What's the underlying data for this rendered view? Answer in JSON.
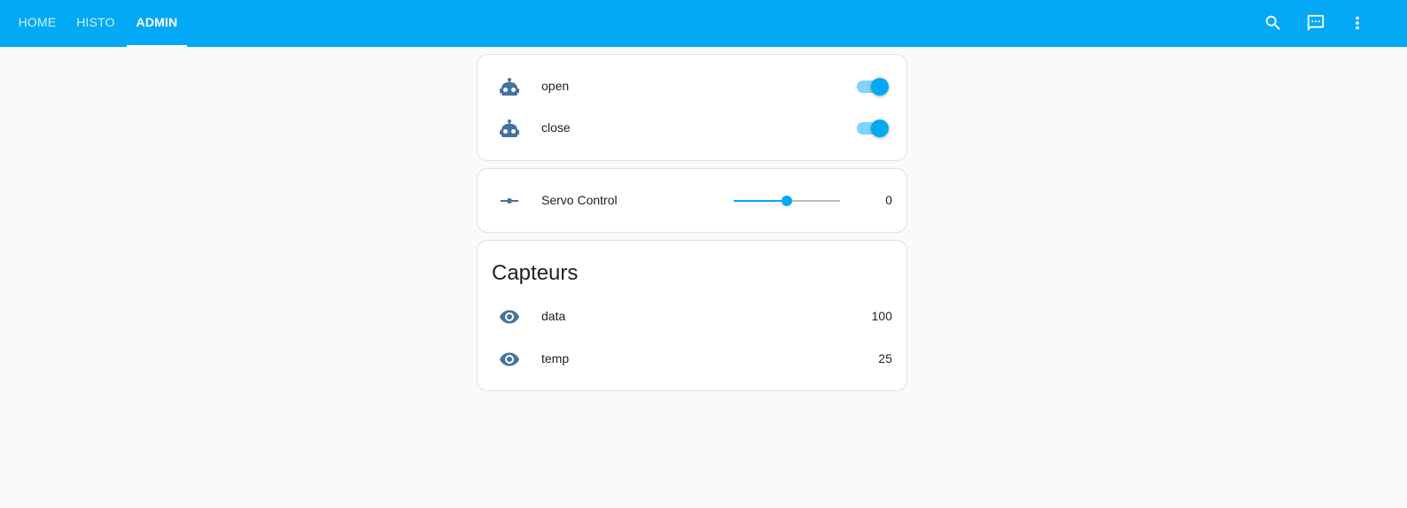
{
  "colors": {
    "primary": "#03a9f4",
    "icon": "#44739e",
    "background": "#fafafa"
  },
  "header": {
    "tabs": [
      {
        "label": "HOME",
        "active": false
      },
      {
        "label": "HISTO",
        "active": false
      },
      {
        "label": "ADMIN",
        "active": true
      }
    ],
    "actions": [
      "search-icon",
      "message-icon",
      "more-vertical-icon"
    ]
  },
  "switches_card": {
    "entities": [
      {
        "icon": "robot-icon",
        "name": "open",
        "state": "on"
      },
      {
        "icon": "robot-icon",
        "name": "close",
        "state": "on"
      }
    ]
  },
  "servo_card": {
    "icon": "slider-icon",
    "name": "Servo Control",
    "value": "0",
    "slider_fraction": 0.5
  },
  "sensors_card": {
    "title": "Capteurs",
    "entities": [
      {
        "icon": "eye-icon",
        "name": "data",
        "value": "100"
      },
      {
        "icon": "eye-icon",
        "name": "temp",
        "value": "25"
      }
    ]
  }
}
